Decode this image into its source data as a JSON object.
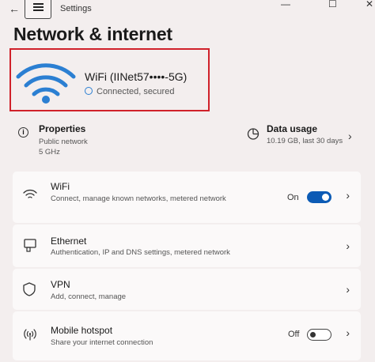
{
  "window": {
    "app_title": "Settings",
    "back_icon": "back-arrow-icon",
    "minimize_symbol": "—",
    "maximize_symbol": "☐",
    "close_symbol": "✕"
  },
  "page": {
    "title": "Network & internet"
  },
  "hero": {
    "ssid": "WiFi (IINet57••••-5G)",
    "status": "Connected, secured",
    "accent_color": "#2b7fd2",
    "highlight_color": "#d0212a"
  },
  "properties": {
    "title": "Properties",
    "network_type": "Public network",
    "band": "5 GHz"
  },
  "data_usage": {
    "title": "Data usage",
    "summary": "10.19 GB, last 30 days"
  },
  "items": [
    {
      "title": "WiFi",
      "subtitle": "Connect, manage known networks, metered network",
      "toggle_label": "On",
      "toggle_on": true,
      "icon": "wifi-icon"
    },
    {
      "title": "Ethernet",
      "subtitle": "Authentication, IP and DNS settings, metered network",
      "icon": "ethernet-icon"
    },
    {
      "title": "VPN",
      "subtitle": "Add, connect, manage",
      "icon": "shield-icon"
    },
    {
      "title": "Mobile hotspot",
      "subtitle": "Share your internet connection",
      "toggle_label": "Off",
      "toggle_on": false,
      "icon": "hotspot-icon"
    }
  ],
  "colors": {
    "toggle_on": "#0c5bb5",
    "background": "#f3eeee",
    "card": "#fbf9f9"
  }
}
